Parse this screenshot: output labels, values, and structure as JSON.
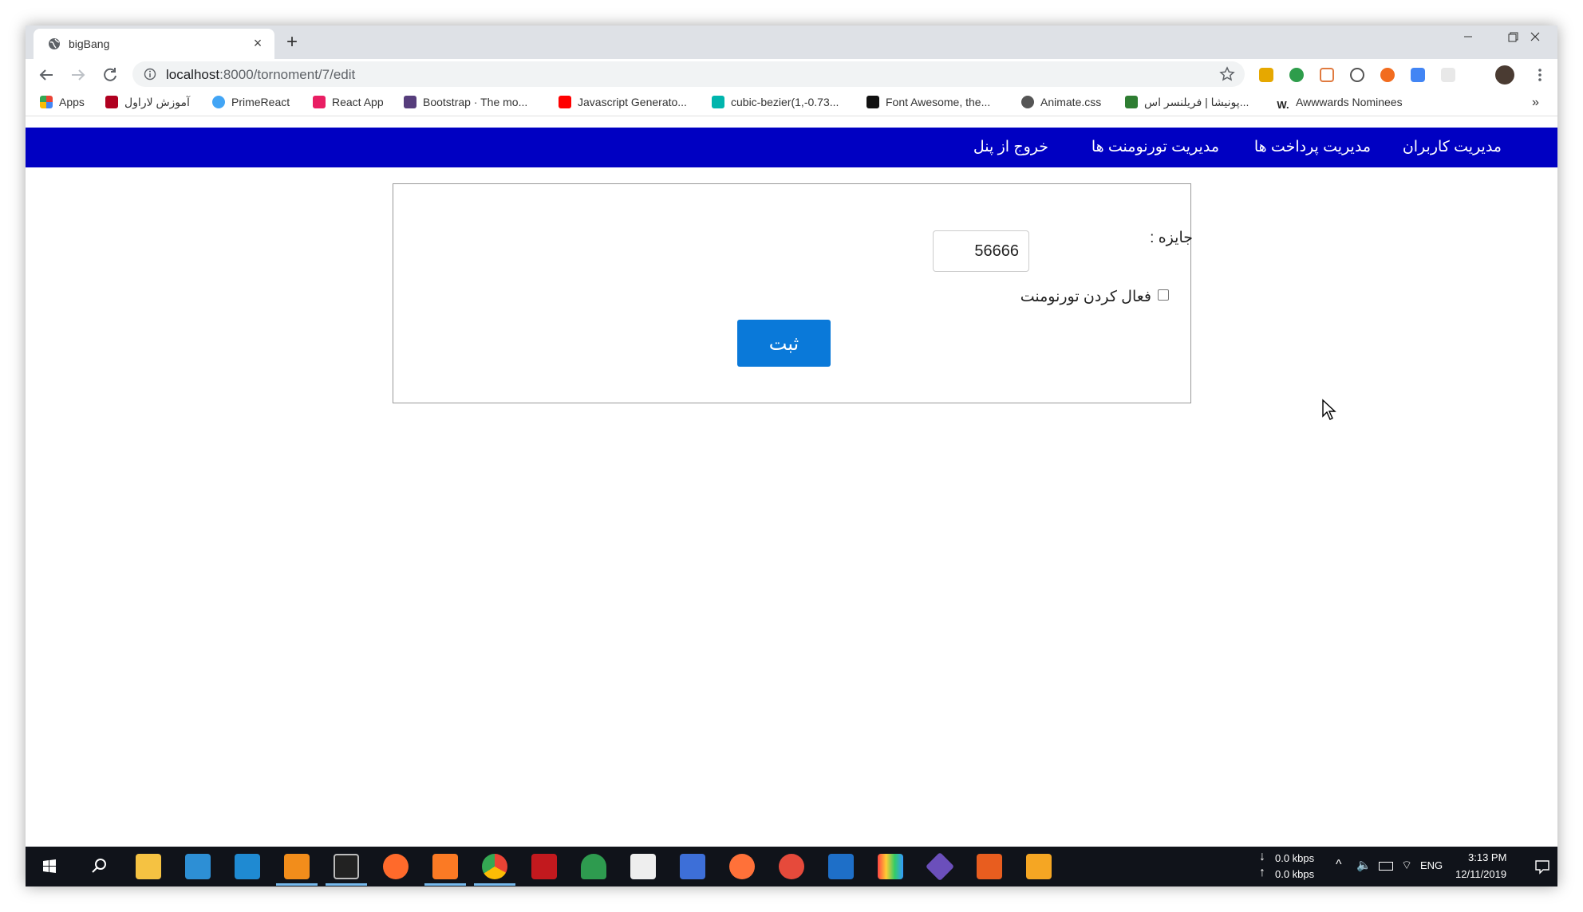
{
  "browser": {
    "tab_title": "bigBang",
    "url_host": "localhost",
    "url_rest": ":8000/tornoment/7/edit"
  },
  "bookmarks": [
    {
      "label": "Apps",
      "icon": "apps-grid-icon",
      "color": "#e94235"
    },
    {
      "label": "آموزش لاراول",
      "icon": "laravel-icon",
      "color": "#b00020"
    },
    {
      "label": "PrimeReact",
      "icon": "primereact-icon",
      "color": "#42a5f5"
    },
    {
      "label": "React App",
      "icon": "react-app-icon",
      "color": "#e91e63"
    },
    {
      "label": "Bootstrap · The mo...",
      "icon": "bootstrap-icon",
      "color": "#563d7c"
    },
    {
      "label": "Javascript Generato...",
      "icon": "youtube-icon",
      "color": "#ff0000"
    },
    {
      "label": "cubic-bezier(1,-0.73...",
      "icon": "cubic-bezier-icon",
      "color": "#00b5ad"
    },
    {
      "label": "Font Awesome, the...",
      "icon": "font-awesome-icon",
      "color": "#111111"
    },
    {
      "label": "Animate.css",
      "icon": "globe-icon",
      "color": "#555555"
    },
    {
      "label": "پونیشا | فریلنسر اس...",
      "icon": "ponisha-icon",
      "color": "#2e7d32"
    },
    {
      "label": "Awwwards Nominees",
      "icon": "awwwards-icon",
      "color": "#222222"
    }
  ],
  "nav": {
    "users": "مدیریت کاربران",
    "payments": "مدیریت پرداخت ها",
    "tournaments": "مدیریت تورنومنت ها",
    "logout": "خروج از پنل"
  },
  "form": {
    "prize_label": "جایزه :",
    "prize_value": "56666",
    "active_label": "فعال کردن تورنومنت",
    "active_checked": false,
    "submit_label": "ثبت"
  },
  "tray": {
    "down_speed": "0.0 kbps",
    "up_speed": "0.0 kbps",
    "lang": "ENG",
    "time": "3:13 PM",
    "date": "12/11/2019"
  },
  "colors": {
    "navbar": "#0000c2",
    "button": "#0a79d9",
    "taskbar": "#10131a"
  }
}
